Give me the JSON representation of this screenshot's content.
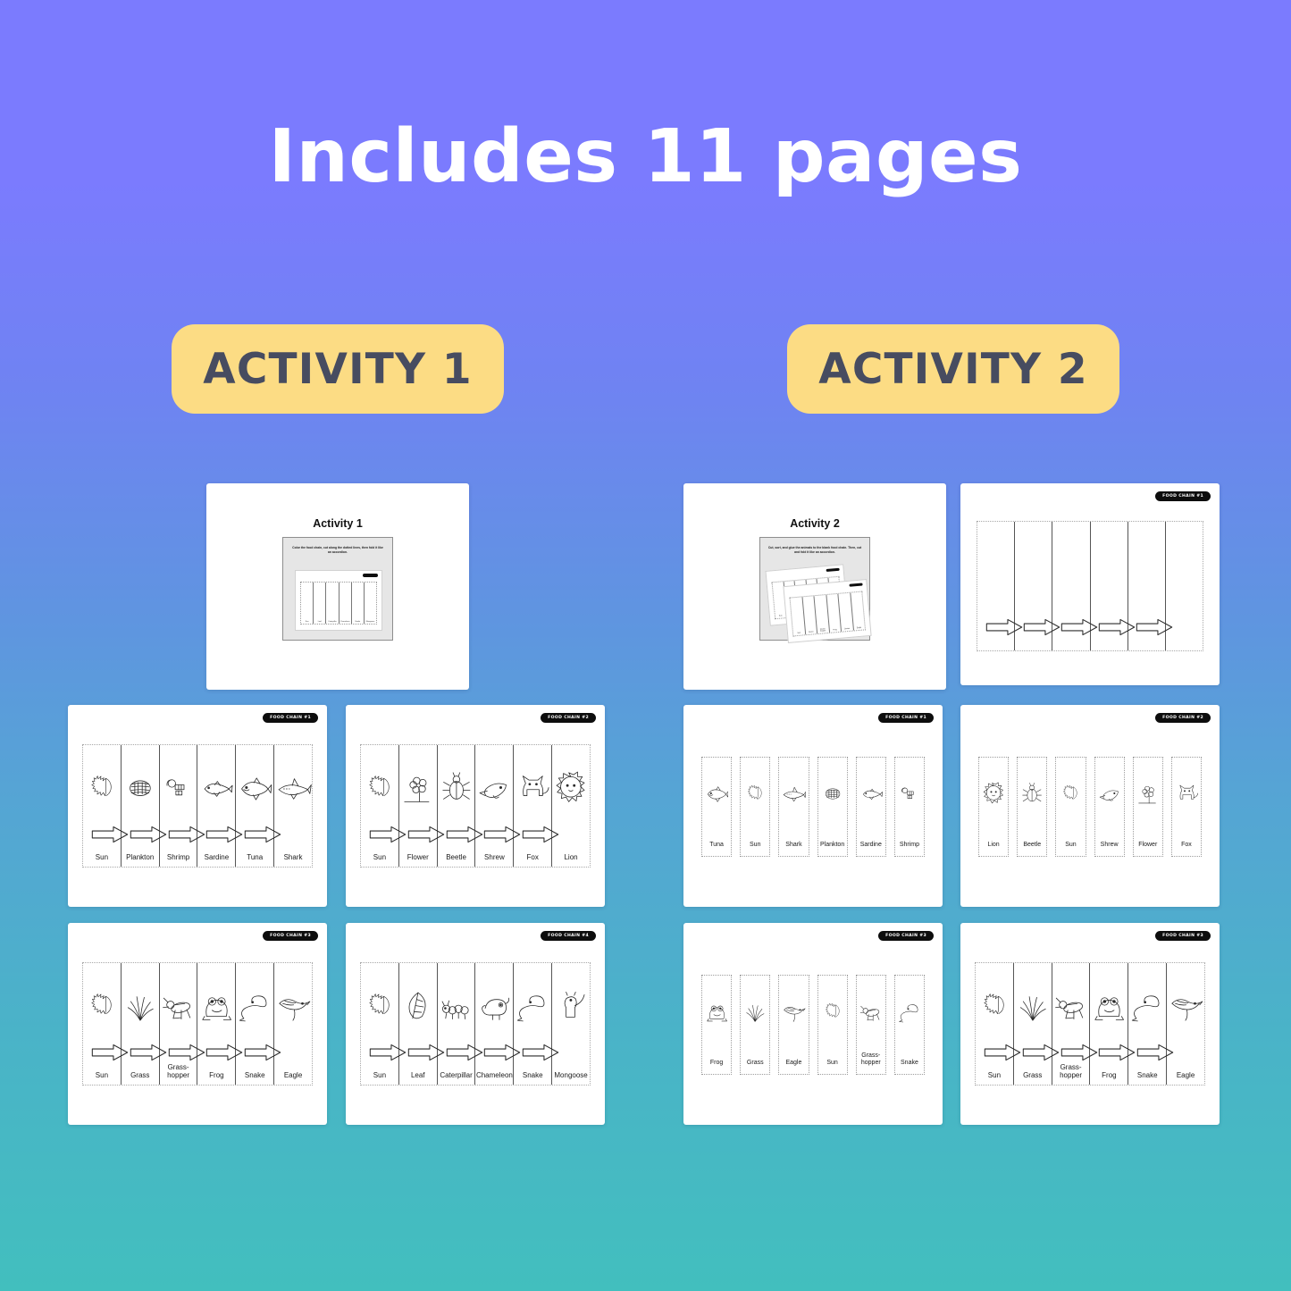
{
  "header": {
    "title": "Includes 11 pages"
  },
  "badges": {
    "activity1": "ACTIVITY 1",
    "activity2": "ACTIVITY 2"
  },
  "colors": {
    "gradient_top": "#7B7BFE",
    "gradient_bottom": "#42BFBE",
    "badge_bg": "#FCDC84",
    "badge_text": "#474C60",
    "card_bg": "#FFFFFF",
    "sheet_badge_bg": "#0D0D0D",
    "line_art": "#2B2B2B"
  },
  "covers": [
    {
      "title": "Activity 1",
      "instruction": "Color the food chain, cut along the dotted lines, then fold it like an accordion.",
      "preview_labels": [
        "Sun",
        "Leaf",
        "Caterpillar",
        "Chameleon",
        "Snake",
        "Mongoose"
      ]
    },
    {
      "title": "Activity 2",
      "instruction": "Cut, sort, and glue the animals to the blank food chain. Then, cut and fold it like an accordion.",
      "preview_labels": [
        "Sun",
        "Grass",
        "Grass-hopper",
        "Frog",
        "Snake",
        "Eagle"
      ]
    }
  ],
  "activity1_sheets": [
    {
      "badge": "FOOD CHAIN #1",
      "labels": [
        "Sun",
        "Plankton",
        "Shrimp",
        "Sardine",
        "Tuna",
        "Shark"
      ],
      "icons": [
        "sun-icon",
        "plankton-icon",
        "shrimp-icon",
        "sardine-icon",
        "tuna-icon",
        "shark-icon"
      ]
    },
    {
      "badge": "FOOD CHAIN #2",
      "labels": [
        "Sun",
        "Flower",
        "Beetle",
        "Shrew",
        "Fox",
        "Lion"
      ],
      "icons": [
        "sun-icon",
        "flower-icon",
        "beetle-icon",
        "shrew-icon",
        "fox-icon",
        "lion-icon"
      ]
    },
    {
      "badge": "FOOD CHAIN #3",
      "labels": [
        "Sun",
        "Grass",
        "Grass-hopper",
        "Frog",
        "Snake",
        "Eagle"
      ],
      "icons": [
        "sun-icon",
        "grass-icon",
        "grasshopper-icon",
        "frog-icon",
        "snake-icon",
        "eagle-icon"
      ]
    },
    {
      "badge": "FOOD CHAIN #4",
      "labels": [
        "Sun",
        "Leaf",
        "Caterpillar",
        "Chameleon",
        "Snake",
        "Mongoose"
      ],
      "icons": [
        "sun-icon",
        "leaf-icon",
        "caterpillar-icon",
        "chameleon-icon",
        "snake-icon",
        "mongoose-icon"
      ]
    }
  ],
  "activity2_blank": {
    "badge": "FOOD CHAIN #1",
    "columns": 6,
    "arrows": 5
  },
  "activity2_cutouts": [
    {
      "badge": "FOOD CHAIN #1",
      "labels": [
        "Tuna",
        "Sun",
        "Shark",
        "Plankton",
        "Sardine",
        "Shrimp"
      ],
      "icons": [
        "tuna-icon",
        "sun-icon",
        "shark-icon",
        "plankton-icon",
        "sardine-icon",
        "shrimp-icon"
      ]
    },
    {
      "badge": "FOOD CHAIN #2",
      "labels": [
        "Lion",
        "Beetle",
        "Sun",
        "Shrew",
        "Flower",
        "Fox"
      ],
      "icons": [
        "lion-icon",
        "beetle-icon",
        "sun-icon",
        "shrew-icon",
        "flower-icon",
        "fox-icon"
      ]
    },
    {
      "badge": "FOOD CHAIN #3",
      "labels": [
        "Frog",
        "Grass",
        "Eagle",
        "Sun",
        "Grass-hopper",
        "Snake"
      ],
      "icons": [
        "frog-icon",
        "grass-icon",
        "eagle-icon",
        "sun-icon",
        "grasshopper-icon",
        "snake-icon"
      ]
    }
  ],
  "activity2_filled": {
    "badge": "FOOD CHAIN #3",
    "labels": [
      "Sun",
      "Grass",
      "Grass-hopper",
      "Frog",
      "Snake",
      "Eagle"
    ],
    "icons": [
      "sun-icon",
      "grass-icon",
      "grasshopper-icon",
      "frog-icon",
      "snake-icon",
      "eagle-icon"
    ]
  }
}
